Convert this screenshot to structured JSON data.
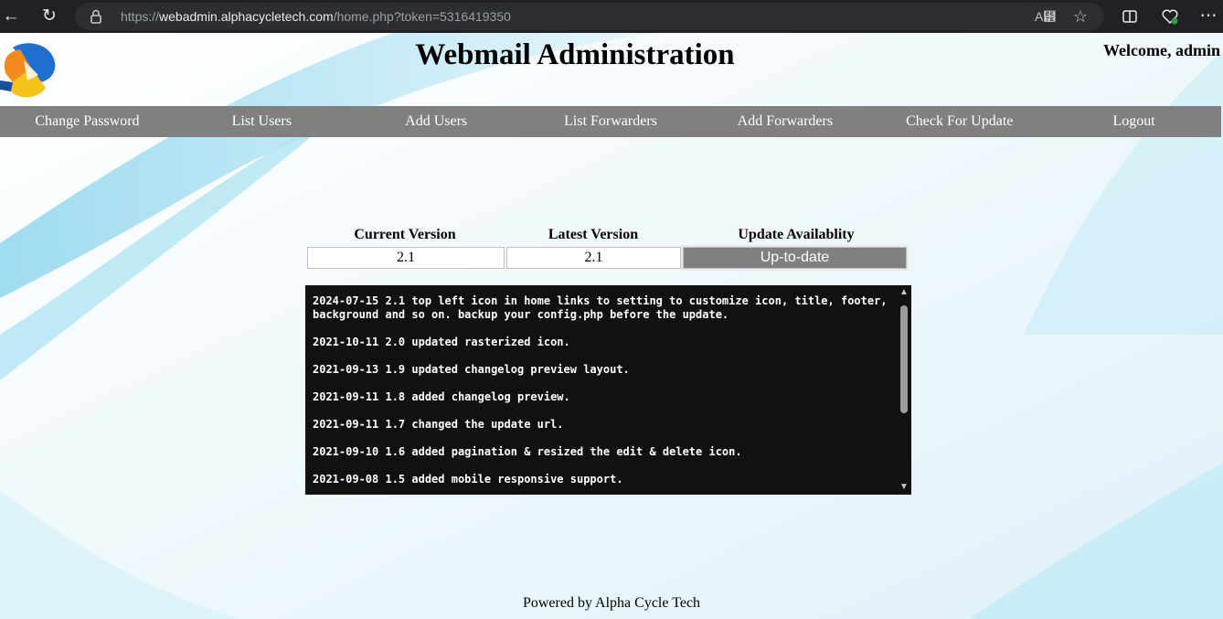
{
  "browser": {
    "url_scheme": "https://",
    "url_host": "webadmin.alphacycletech.com",
    "url_path": "/home.php?token=5316419350"
  },
  "header": {
    "title": "Webmail Administration",
    "welcome": "Welcome, admin"
  },
  "nav": {
    "items": [
      {
        "label": "Change Password"
      },
      {
        "label": "List Users"
      },
      {
        "label": "Add Users"
      },
      {
        "label": "List Forwarders"
      },
      {
        "label": "Add Forwarders"
      },
      {
        "label": "Check For Update"
      },
      {
        "label": "Logout"
      }
    ]
  },
  "version": {
    "current_header": "Current Version",
    "latest_header": "Latest Version",
    "availability_header": "Update Availablity",
    "current_value": "2.1",
    "latest_value": "2.1",
    "status": "Up-to-date"
  },
  "changelog": [
    "2024-07-15 2.1 top left icon in home links to setting to customize icon, title, footer, background and so on. backup your config.php before the update.",
    "2021-10-11 2.0 updated rasterized icon.",
    "2021-09-13 1.9 updated changelog preview layout.",
    "2021-09-11 1.8 added changelog preview.",
    "2021-09-11 1.7 changed the update url.",
    "2021-09-10 1.6 added pagination & resized the edit & delete icon.",
    "2021-09-08 1.5 added mobile responsive support."
  ],
  "footer": {
    "text": "Powered by Alpha Cycle Tech"
  },
  "colors": {
    "nav_bg": "#808080",
    "changelog_bg": "#111111",
    "status_bg": "#808080"
  }
}
